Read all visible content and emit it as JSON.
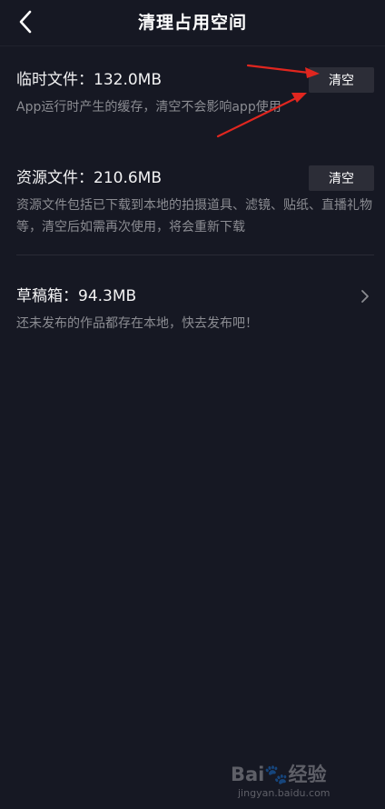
{
  "header": {
    "title": "清理占用空间",
    "back_icon": "chevron-left-icon"
  },
  "temp_files": {
    "title": "临时文件：132.0MB",
    "description": "App运行时产生的缓存，清空不会影响app使用",
    "button_label": "清空"
  },
  "resource_files": {
    "title": "资源文件：210.6MB",
    "description": "资源文件包括已下载到本地的拍摄道具、滤镜、贴纸、直播礼物等，清空后如需再次使用，将会重新下载",
    "button_label": "清空"
  },
  "drafts": {
    "title": "草稿箱：94.3MB",
    "description": "还未发布的作品都存在本地，快去发布吧！",
    "arrow_icon": "chevron-right-icon"
  },
  "watermark": {
    "logo": "Bai🐾经验",
    "url": "jingyan.baidu.com"
  },
  "colors": {
    "background": "#161823",
    "button_bg": "#2c2d37",
    "secondary_text": "#8b8c92",
    "annotation_arrow": "#e0261f"
  }
}
